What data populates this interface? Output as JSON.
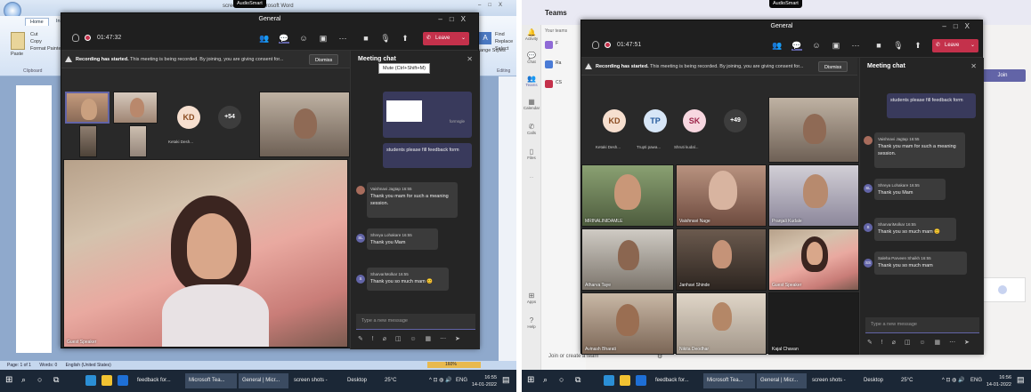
{
  "left": {
    "word_title": "screen shots - Microsoft Word",
    "ribbon_tabs": [
      "Home",
      "Insert"
    ],
    "ribbon": {
      "cut": "Cut",
      "copy": "Copy",
      "paste": "Paste",
      "format_painter": "Format Painter",
      "clipboard": "Clipboard",
      "find": "Find",
      "replace": "Replace",
      "select": "Select",
      "change_styles": "Change Styles",
      "editing": "Editing"
    },
    "status": {
      "page": "Page: 1 of 1",
      "words": "Words: 0",
      "language": "English (United States)",
      "zoom": "160%"
    },
    "audiosmart": "AudioSmart",
    "teams": {
      "title": "General",
      "timer": "01:47:32",
      "leave": "Leave",
      "banner_bold": "Recording has started.",
      "banner_text": "This meeting is being recorded. By joining, you are giving consent for...",
      "dismiss": "Dismiss",
      "tooltip": "Mute (Ctrl+Shift+M)",
      "chat_title": "Meeting chat",
      "avatars": [
        {
          "initials": "KD",
          "color": "#f6dfcf",
          "text_color": "#8a4b20",
          "name": "Ketaki Desh..."
        },
        {
          "initials": "+54",
          "color": "#3d3d3d",
          "text_color": "#ffffff",
          "name": ""
        }
      ],
      "main_speaker": "Guest Speaker",
      "shared_file": "formsgle",
      "messages": [
        {
          "from": "",
          "time": "",
          "text": "students please fill feedback form",
          "mine": true
        },
        {
          "from": "Vaishnavi Jagtap",
          "time": "16:55",
          "text": "Thank you mam for such a meaning session."
        },
        {
          "from": "Shreya Lohakare",
          "time": "16:55",
          "text": "Thank you Mam",
          "initials": "SL"
        },
        {
          "from": "SharvariMolkar",
          "time": "16:55",
          "text": "Thank you so much mam",
          "initials": "S"
        }
      ],
      "input_placeholder": "Type a new message"
    },
    "taskbar": {
      "items": [
        "feedback for...",
        "Microsoft Tea...",
        "General | Micr...",
        "screen shots -",
        "Desktop"
      ],
      "weather": "25°C",
      "lang": "ENG",
      "time": "16:55",
      "date": "14-01-2022"
    }
  },
  "right": {
    "audiosmart": "AudioSmart",
    "teams_label": "Teams",
    "your_teams": "Your teams",
    "join_or_create": "Join or create a team",
    "join": "Join",
    "rail": [
      "Activity",
      "Chat",
      "Teams",
      "Calendar",
      "Calls",
      "Files",
      "...",
      "Apps",
      "Help"
    ],
    "team_rows": [
      {
        "label": "F",
        "color": "#8f6ad6"
      },
      {
        "label": "Ra",
        "color": "#4a7bd6"
      },
      {
        "label": "CS",
        "color": "#c4314b"
      }
    ],
    "teams": {
      "title": "General",
      "timer": "01:47:51",
      "leave": "Leave",
      "banner_bold": "Recording has started.",
      "banner_text": "This meeting is being recorded. By joining, you are giving consent for...",
      "dismiss": "Dismiss",
      "chat_title": "Meeting chat",
      "avatars": [
        {
          "initials": "KD",
          "color": "#f6dfcf",
          "text_color": "#8a4b20",
          "name": "Ketaki Desh..."
        },
        {
          "initials": "TP",
          "color": "#d7e6f7",
          "text_color": "#245a9c",
          "name": "Trupti pawa..."
        },
        {
          "initials": "SK",
          "color": "#f7d7e0",
          "text_color": "#9c2449",
          "name": "Shruti kudal..."
        },
        {
          "initials": "+49",
          "color": "#3d3d3d",
          "text_color": "#ffffff",
          "name": ""
        }
      ],
      "tiles": [
        "MRINALINIDAMLE",
        "Vaishnavi Nage",
        "Pranjali Kudale",
        "Atharva Taye",
        "Janhavi Shinde",
        "Guest Speaker",
        "Avinash Bharati",
        "Nikita Deodhar",
        "Kajal Chavan"
      ],
      "messages": [
        {
          "from": "",
          "time": "",
          "text": "students please fill feedback form",
          "mine": true
        },
        {
          "from": "Vaishnavi Jagtap",
          "time": "16:55",
          "text": "Thank you mam for such a meaning session."
        },
        {
          "from": "Shreya Lohakare",
          "time": "16:55",
          "text": "Thank you Mam",
          "initials": "SL"
        },
        {
          "from": "SharvariMolkar",
          "time": "16:55",
          "text": "Thank you so much mam",
          "initials": "S"
        },
        {
          "from": "Saleha Parveen Shaikh",
          "time": "16:55",
          "text": "Thank you so much mam",
          "initials": "SS"
        }
      ],
      "input_placeholder": "Type a new message"
    },
    "taskbar": {
      "items": [
        "feedback for...",
        "Microsoft Tea...",
        "General | Micr...",
        "screen shots -",
        "Desktop"
      ],
      "weather": "25°C",
      "lang": "ENG",
      "time": "16:56",
      "date": "14-01-2022"
    }
  },
  "colors": {
    "teams_dark": "#292929",
    "leave_red": "#c4314b",
    "teams_purple": "#6264a7",
    "taskbar": "#1b2736"
  }
}
